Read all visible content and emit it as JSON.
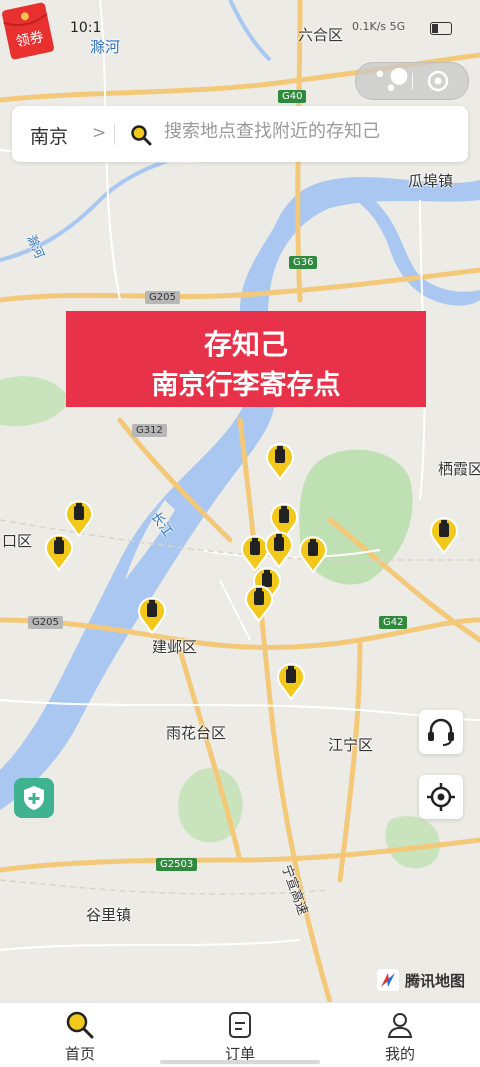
{
  "status": {
    "time": "10:1",
    "network": "0.1K/s 5G"
  },
  "city": "南京",
  "search": {
    "placeholder": "搜索地点查找附近的存知己"
  },
  "banner": {
    "line1": "存知己",
    "line2": "南京行李寄存点"
  },
  "map_labels": [
    "滁河",
    "六合区",
    "瓜埠镇",
    "滁河",
    "栖霞区",
    "口区",
    "长江",
    "建邺区",
    "雨花台区",
    "江宁区",
    "谷里镇",
    "宁宣高速"
  ],
  "road_labels": [
    "G40",
    "G36",
    "G205",
    "G312",
    "G205",
    "G42",
    "G2503"
  ],
  "coupon": {
    "label": "领券"
  },
  "map_logo": "腾讯地图",
  "tabs": [
    {
      "label": "首页",
      "icon": "search-icon"
    },
    {
      "label": "订单",
      "icon": "order-icon"
    },
    {
      "label": "我的",
      "icon": "profile-icon"
    }
  ],
  "colors": {
    "brand_yellow": "#f2c81a",
    "banner_red": "#e8324a",
    "river_blue": "#a9c7f0",
    "park_green": "#b9dfae"
  }
}
